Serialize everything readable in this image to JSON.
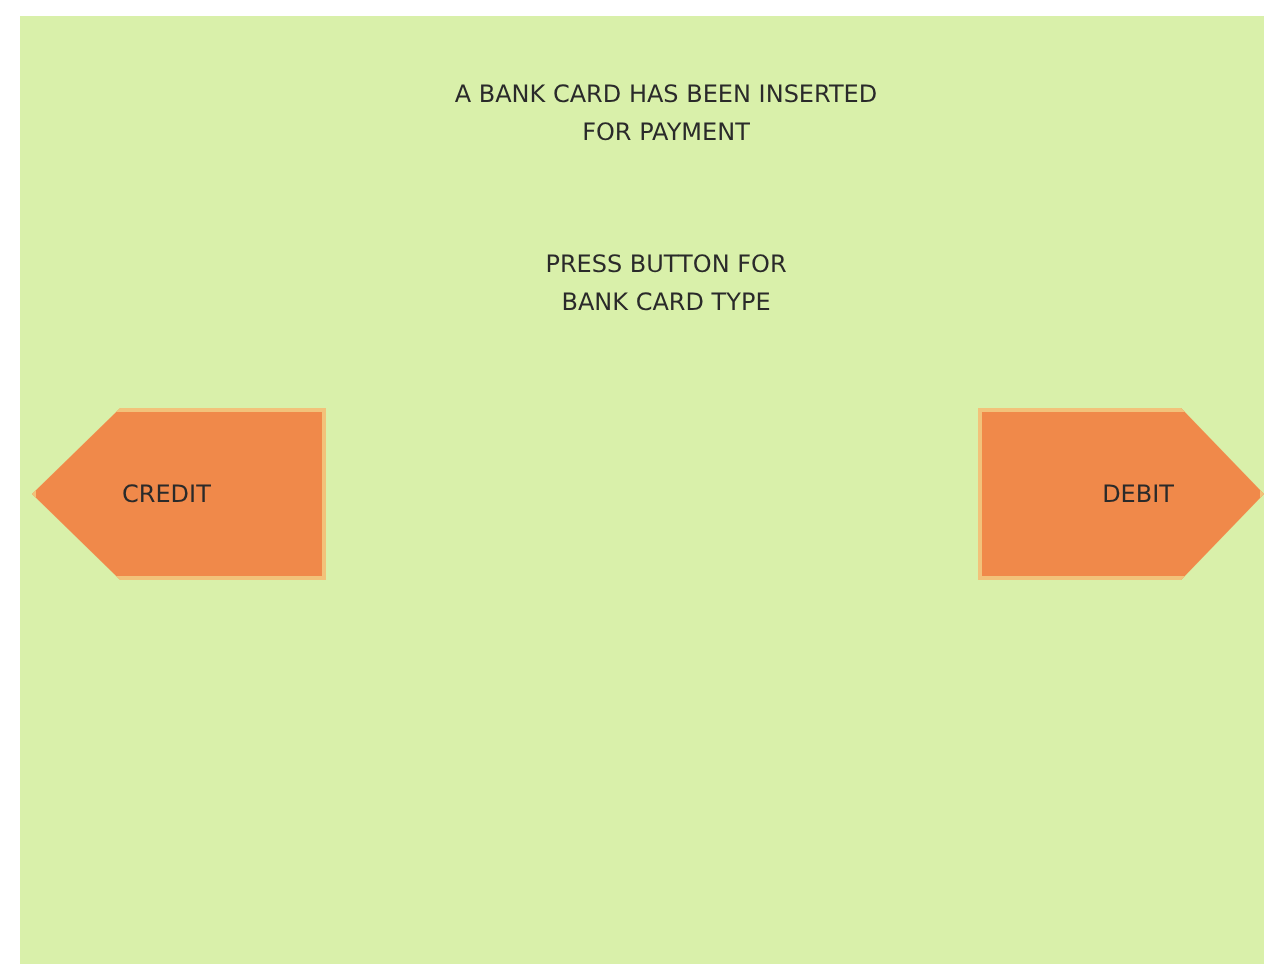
{
  "messages": [
    "A BANK CARD HAS BEEN INSERTED\nFOR PAYMENT",
    "PRESS BUTTON FOR\nBANK CARD TYPE"
  ],
  "buttons": [
    {
      "label": "CREDIT",
      "kind": "left"
    },
    {
      "label": "DEBIT",
      "kind": "right"
    }
  ]
}
